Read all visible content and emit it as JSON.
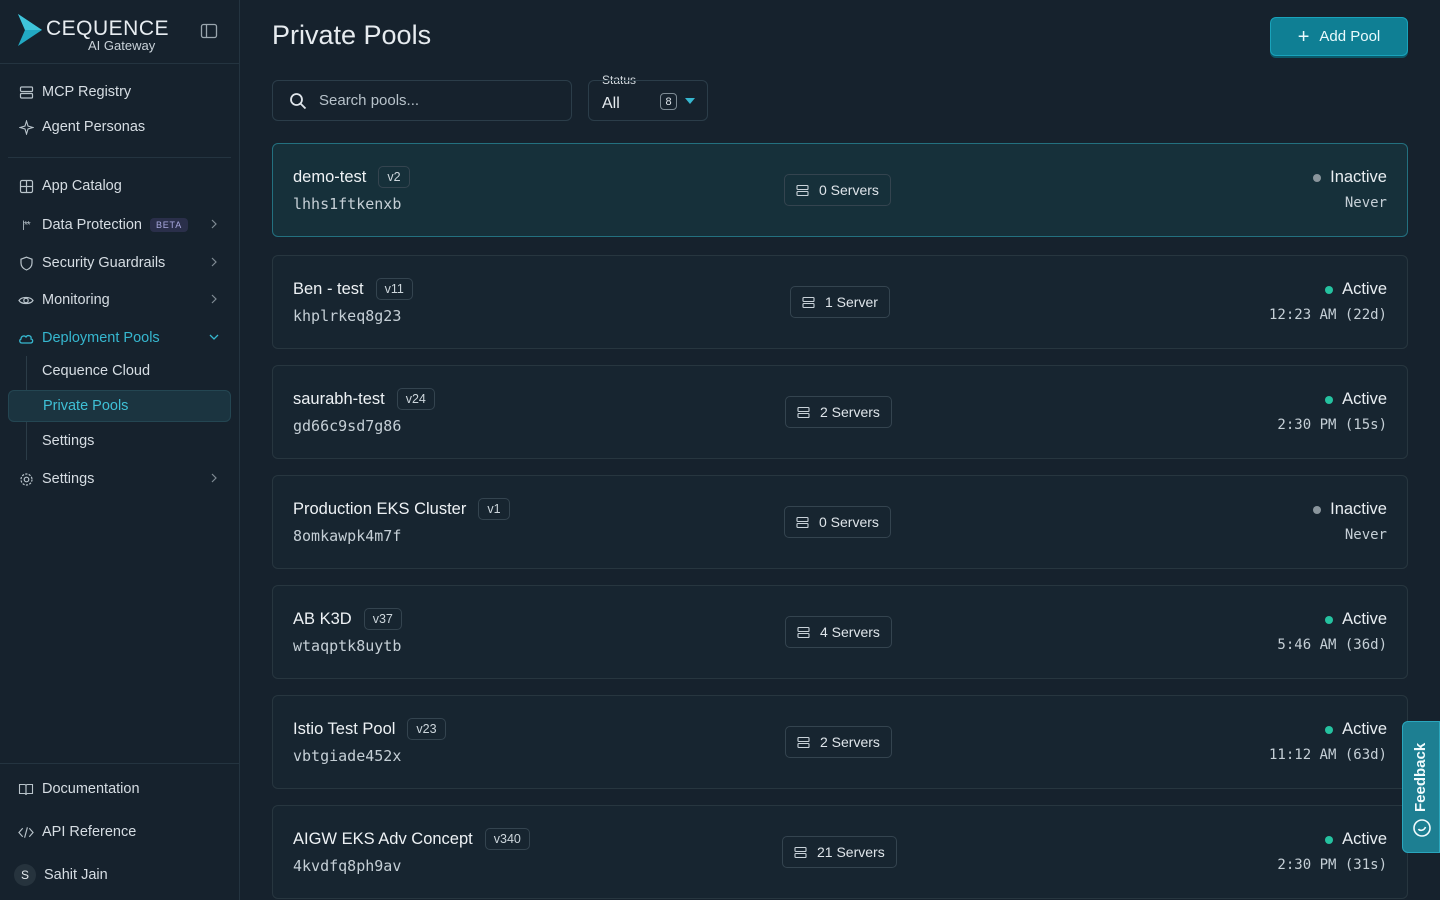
{
  "brand": {
    "name": "CEQUENCE",
    "sub": "AI Gateway"
  },
  "sidebar": {
    "top_items": [
      {
        "label": "MCP Registry",
        "icon": "server-icon"
      },
      {
        "label": "Agent Personas",
        "icon": "sparkle-icon"
      }
    ],
    "items": [
      {
        "label": "App Catalog",
        "icon": "grid-icon"
      },
      {
        "label": "Data Protection",
        "badge": "BETA",
        "icon": "masked-data-icon"
      },
      {
        "label": "Security Guardrails",
        "icon": "shield-icon"
      },
      {
        "label": "Monitoring",
        "icon": "eye-icon"
      },
      {
        "label": "Deployment Pools",
        "icon": "cloud-icon"
      },
      {
        "label": "Settings",
        "icon": "gear-icon"
      }
    ],
    "sub_items": [
      "Cequence Cloud",
      "Private Pools",
      "Settings"
    ],
    "footer": [
      {
        "label": "Documentation",
        "icon": "book-icon"
      },
      {
        "label": "API Reference",
        "icon": "code-icon"
      }
    ],
    "user": {
      "initial": "S",
      "name": "Sahit Jain"
    }
  },
  "page": {
    "title": "Private Pools",
    "add_button": "Add Pool",
    "search_placeholder": "Search pools...",
    "status_label": "Status",
    "status_value": "All",
    "status_count": "8"
  },
  "pools": [
    {
      "name": "demo-test",
      "version": "v2",
      "id": "lhhs1ftkenxb",
      "servers": "0 Servers",
      "status": "Inactive",
      "last": "Never"
    },
    {
      "name": "Ben - test",
      "version": "v11",
      "id": "khplrkeq8g23",
      "servers": "1 Server",
      "status": "Active",
      "last": "12:23 AM (22d)"
    },
    {
      "name": "saurabh-test",
      "version": "v24",
      "id": "gd66c9sd7g86",
      "servers": "2 Servers",
      "status": "Active",
      "last": "2:30 PM (15s)"
    },
    {
      "name": "Production EKS Cluster",
      "version": "v1",
      "id": "8omkawpk4m7f",
      "servers": "0 Servers",
      "status": "Inactive",
      "last": "Never"
    },
    {
      "name": "AB K3D",
      "version": "v37",
      "id": "wtaqptk8uytb",
      "servers": "4 Servers",
      "status": "Active",
      "last": "5:46 AM (36d)"
    },
    {
      "name": "Istio Test Pool",
      "version": "v23",
      "id": "vbtgiade452x",
      "servers": "2 Servers",
      "status": "Active",
      "last": "11:12 AM (63d)"
    },
    {
      "name": "AIGW EKS Adv Concept",
      "version": "v340",
      "id": "4kvdfq8ph9av",
      "servers": "21 Servers",
      "status": "Active",
      "last": "2:30 PM (31s)"
    }
  ],
  "feedback": {
    "label": "Feedback"
  },
  "colors": {
    "accent": "#36b7cf",
    "active": "#25c2a0",
    "inactive": "#8a959c",
    "button": "#0f7f94"
  }
}
